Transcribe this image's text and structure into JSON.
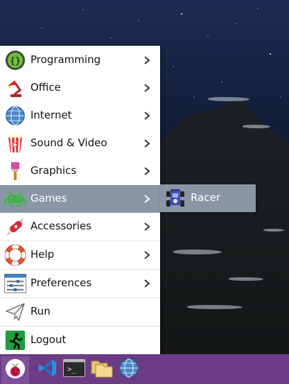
{
  "menu": {
    "items": [
      {
        "label": "Programming",
        "icon": "code-braces-icon"
      },
      {
        "label": "Office",
        "icon": "desk-lamp-icon"
      },
      {
        "label": "Internet",
        "icon": "globe-icon"
      },
      {
        "label": "Sound & Video",
        "icon": "popcorn-icon"
      },
      {
        "label": "Graphics",
        "icon": "paintbrush-icon"
      },
      {
        "label": "Games",
        "icon": "space-invader-icon"
      },
      {
        "label": "Accessories",
        "icon": "swiss-knife-icon"
      },
      {
        "label": "Help",
        "icon": "lifebuoy-icon"
      },
      {
        "label": "Preferences",
        "icon": "sliders-icon"
      },
      {
        "label": "Run",
        "icon": "paper-plane-icon"
      },
      {
        "label": "Logout",
        "icon": "exit-person-icon"
      }
    ],
    "active_item": "Games",
    "highlight_color": "#8a96a6"
  },
  "submenu": {
    "items": [
      {
        "label": "Racer",
        "icon": "race-car-icon"
      }
    ]
  },
  "taskbar": {
    "color": "#6b3b85",
    "buttons": [
      {
        "icon": "raspberry-pi-icon"
      },
      {
        "icon": "vscode-icon"
      },
      {
        "icon": "terminal-icon"
      },
      {
        "icon": "folder-icon"
      },
      {
        "icon": "globe-browser-icon"
      }
    ]
  }
}
